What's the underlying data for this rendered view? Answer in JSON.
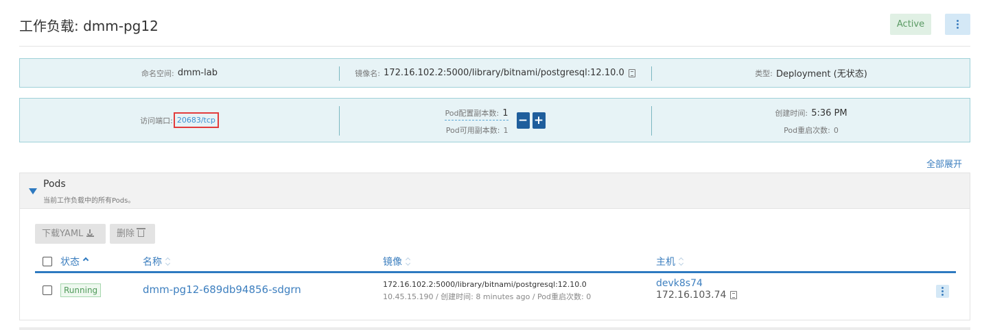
{
  "header": {
    "title": "工作负载: dmm-pg12",
    "status": "Active",
    "menu_icon": "kebab-icon"
  },
  "info": {
    "namespace_label": "命名空间:",
    "namespace_value": "dmm-lab",
    "image_label": "镜像名:",
    "image_value": "172.16.102.2:5000/library/bitnami/postgresql:12.10.0",
    "type_label": "类型:",
    "type_value": "Deployment (无状态)",
    "port_label": "访问端口:",
    "port_value": "20683/tcp",
    "scale_config_label": "Pod配置副本数:",
    "scale_config_value": "1",
    "scale_available_label": "Pod可用副本数:",
    "scale_available_value": "1",
    "minus": "−",
    "plus": "+",
    "created_label": "创建时间:",
    "created_value": "5:36 PM",
    "restarts_label": "Pod重启次数:",
    "restarts_value": "0"
  },
  "expand_all": "全部展开",
  "pods": {
    "title": "Pods",
    "subtitle": "当前工作负载中的所有Pods。",
    "toolbar": {
      "download_yaml": "下载YAML",
      "delete": "删除"
    },
    "columns": {
      "state": "状态",
      "name": "名称",
      "image": "镜像",
      "host": "主机"
    },
    "rows": [
      {
        "state": "Running",
        "name": "dmm-pg12-689db94856-sdgrn",
        "image": "172.16.102.2:5000/library/bitnami/postgresql:12.10.0",
        "detail": "10.45.15.190 / 创建时间: 8 minutes ago / Pod重启次数: 0",
        "host_name": "devk8s74",
        "host_ip": "172.16.103.74"
      }
    ]
  },
  "colors": {
    "accent": "#3d7fbf",
    "info_bg": "#e7f3f6",
    "info_border": "#9dd0d8",
    "active_badge_bg": "#e0f0e4",
    "running": "#4f9a59",
    "highlight": "#e23b3b"
  }
}
